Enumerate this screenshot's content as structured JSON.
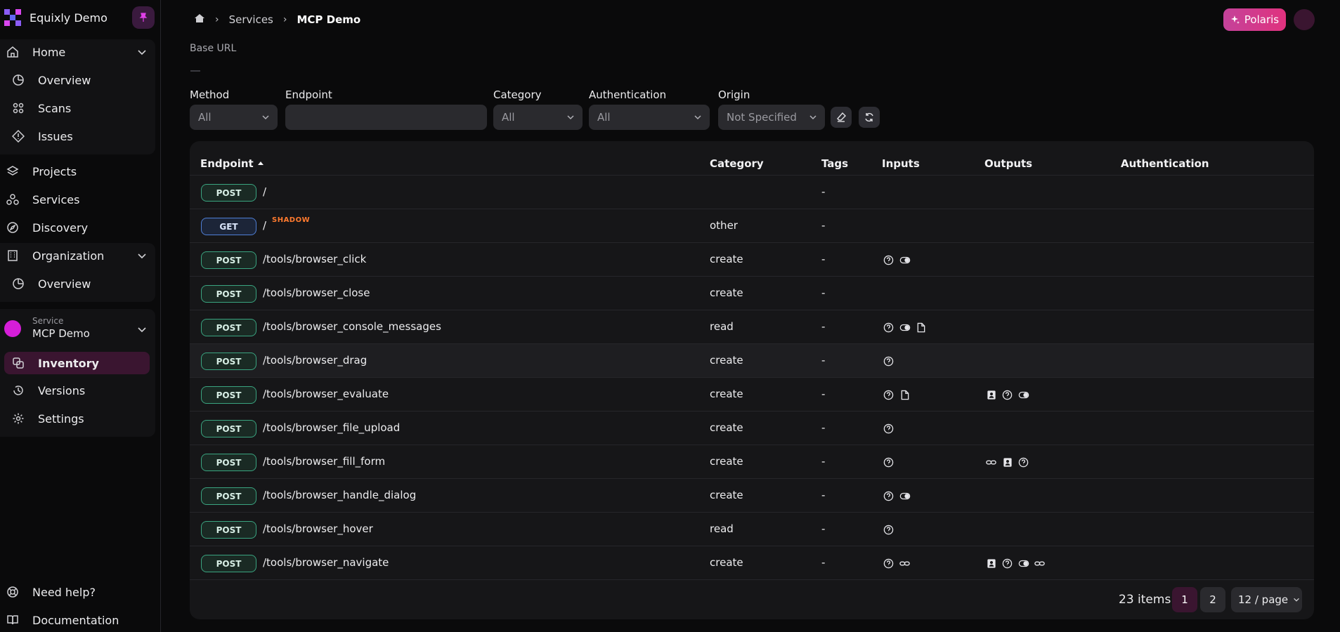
{
  "brand": {
    "name": "Equixly Demo"
  },
  "sidebar": {
    "home": {
      "label": "Home",
      "children": [
        {
          "label": "Overview"
        },
        {
          "label": "Scans"
        },
        {
          "label": "Issues"
        }
      ]
    },
    "projects": "Projects",
    "services": "Services",
    "discovery": "Discovery",
    "organization": {
      "label": "Organization",
      "children": [
        {
          "label": "Overview"
        }
      ]
    },
    "service": {
      "caption": "Service",
      "name": "MCP Demo",
      "children": [
        {
          "label": "Inventory"
        },
        {
          "label": "Versions"
        },
        {
          "label": "Settings"
        }
      ]
    },
    "help": "Need help?",
    "docs": "Documentation"
  },
  "breadcrumb": {
    "level1": "Services",
    "current": "MCP Demo"
  },
  "polaris": {
    "label": "Polaris"
  },
  "base_url": {
    "label": "Base URL"
  },
  "filters": {
    "method": {
      "label": "Method",
      "value": "All"
    },
    "endpoint": {
      "label": "Endpoint",
      "value": ""
    },
    "category": {
      "label": "Category",
      "value": "All"
    },
    "authentication": {
      "label": "Authentication",
      "value": "All"
    },
    "origin": {
      "label": "Origin",
      "value": "Not Specified"
    }
  },
  "table": {
    "columns": [
      "Endpoint",
      "Category",
      "Tags",
      "Inputs",
      "Outputs",
      "Authentication"
    ],
    "rows": [
      {
        "method": "POST",
        "path": "/",
        "category": "",
        "tags": "-",
        "inputs": [],
        "outputs": []
      },
      {
        "method": "GET",
        "path": "/",
        "badge": "SHADOW",
        "category": "other",
        "tags": "-",
        "inputs": [],
        "outputs": []
      },
      {
        "method": "POST",
        "path": "/tools/browser_click",
        "category": "create",
        "tags": "-",
        "inputs": [
          "question-icon",
          "toggle-icon"
        ],
        "outputs": []
      },
      {
        "method": "POST",
        "path": "/tools/browser_close",
        "category": "create",
        "tags": "-",
        "inputs": [],
        "outputs": []
      },
      {
        "method": "POST",
        "path": "/tools/browser_console_messages",
        "category": "read",
        "tags": "-",
        "inputs": [
          "question-icon",
          "toggle-icon",
          "file-icon"
        ],
        "outputs": []
      },
      {
        "method": "POST",
        "path": "/tools/browser_drag",
        "category": "create",
        "tags": "-",
        "inputs": [
          "question-icon"
        ],
        "outputs": []
      },
      {
        "method": "POST",
        "path": "/tools/browser_evaluate",
        "category": "create",
        "tags": "-",
        "inputs": [
          "question-icon",
          "file-icon"
        ],
        "outputs": [
          "contact-icon",
          "question-icon",
          "toggle-icon"
        ]
      },
      {
        "method": "POST",
        "path": "/tools/browser_file_upload",
        "category": "create",
        "tags": "-",
        "inputs": [
          "question-icon"
        ],
        "outputs": []
      },
      {
        "method": "POST",
        "path": "/tools/browser_fill_form",
        "category": "create",
        "tags": "-",
        "inputs": [
          "question-icon"
        ],
        "outputs": [
          "link-icon",
          "contact-icon",
          "question-icon"
        ]
      },
      {
        "method": "POST",
        "path": "/tools/browser_handle_dialog",
        "category": "create",
        "tags": "-",
        "inputs": [
          "question-icon",
          "toggle-icon"
        ],
        "outputs": []
      },
      {
        "method": "POST",
        "path": "/tools/browser_hover",
        "category": "read",
        "tags": "-",
        "inputs": [
          "question-icon"
        ],
        "outputs": []
      },
      {
        "method": "POST",
        "path": "/tools/browser_navigate",
        "category": "create",
        "tags": "-",
        "inputs": [
          "question-icon",
          "link-icon"
        ],
        "outputs": [
          "contact-icon",
          "question-icon",
          "toggle-icon",
          "link-icon"
        ]
      }
    ]
  },
  "pagination": {
    "total": "23 items",
    "pages": [
      "1",
      "2"
    ],
    "current": "1",
    "page_size": "12 / page"
  },
  "colors": {
    "accent": "#d51ed8",
    "post": "#3aa480",
    "get": "#4f7fd6",
    "shadow": "#ff7a2e"
  }
}
